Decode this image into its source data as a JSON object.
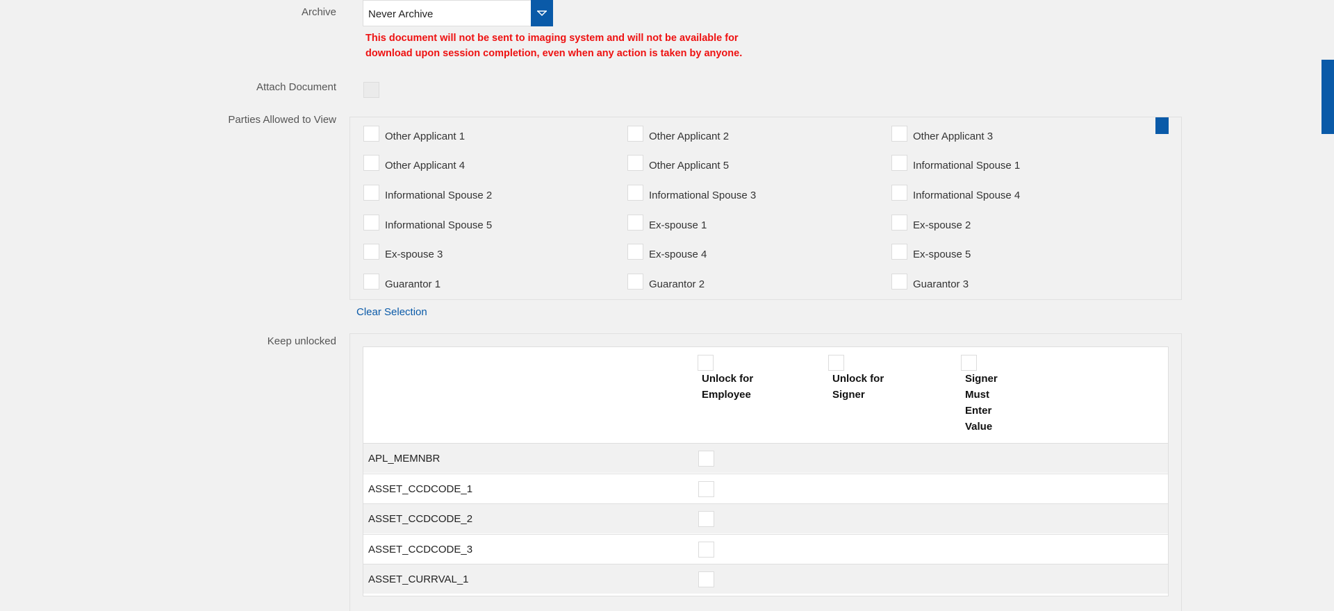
{
  "form": {
    "archive": {
      "label": "Archive",
      "selected": "Never Archive",
      "warning": "This document will not be sent to imaging system and will not be available for download upon session completion, even when any action is taken by anyone."
    },
    "attach_document": {
      "label": "Attach Document"
    },
    "parties": {
      "label": "Parties Allowed to View",
      "items": [
        "Other Applicant 1",
        "Other Applicant 2",
        "Other Applicant 3",
        "Other Applicant 4",
        "Other Applicant 5",
        "Informational Spouse 1",
        "Informational Spouse 2",
        "Informational Spouse 3",
        "Informational Spouse 4",
        "Informational Spouse 5",
        "Ex-spouse 1",
        "Ex-spouse 2",
        "Ex-spouse 3",
        "Ex-spouse 4",
        "Ex-spouse 5",
        "Guarantor 1",
        "Guarantor 2",
        "Guarantor 3"
      ],
      "clear_label": "Clear Selection"
    },
    "keep_unlocked": {
      "label": "Keep unlocked",
      "columns": [
        "Unlock for Employee",
        "Unlock for Signer",
        "Signer Must Enter Value"
      ],
      "rows": [
        "APL_MEMNBR",
        "ASSET_CCDCODE_1",
        "ASSET_CCDCODE_2",
        "ASSET_CCDCODE_3",
        "ASSET_CURRVAL_1"
      ]
    }
  },
  "colors": {
    "accent": "#0a5aa8",
    "warning": "#ee1111",
    "background": "#f1f1f1"
  }
}
